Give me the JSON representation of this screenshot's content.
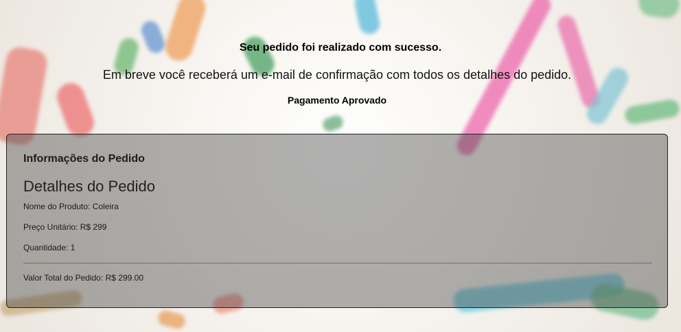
{
  "header": {
    "title": "Seu pedido foi realizado com sucesso.",
    "message": "Em breve você receberá um e-mail de confirmação com todos os detalhes do pedido.",
    "payment_status": "Pagamento Aprovado"
  },
  "order_card": {
    "title": "Informações do Pedido",
    "subtitle": "Detalhes do Pedido",
    "product_name": "Nome do Produto: Coleira",
    "unit_price": "Preço Unitário: R$ 299",
    "quantity": "Quantidade: 1",
    "total": "Valor Total do Pedido: R$ 299.00"
  }
}
